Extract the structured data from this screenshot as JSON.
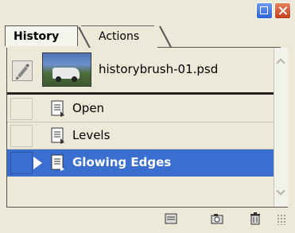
{
  "window": {
    "minimize_icon": "restore-icon",
    "close_icon": "close-icon"
  },
  "tabs": [
    {
      "label": "History",
      "active": true
    },
    {
      "label": "Actions",
      "active": false
    }
  ],
  "panel_menu_icon": "triangle-right-icon",
  "snapshot": {
    "label": "historybrush-01.psd",
    "brush_icon": "history-brush-icon"
  },
  "states": [
    {
      "label": "Open",
      "icon": "document-icon",
      "active": false
    },
    {
      "label": "Levels",
      "icon": "document-icon",
      "active": false
    },
    {
      "label": "Glowing Edges",
      "icon": "document-icon",
      "active": true
    }
  ],
  "bottom_icons": [
    "new-document-from-state-icon",
    "camera-icon",
    "trash-icon"
  ],
  "colors": {
    "selection": "#3a6fd0",
    "panel_bg": "#ece9d8"
  }
}
